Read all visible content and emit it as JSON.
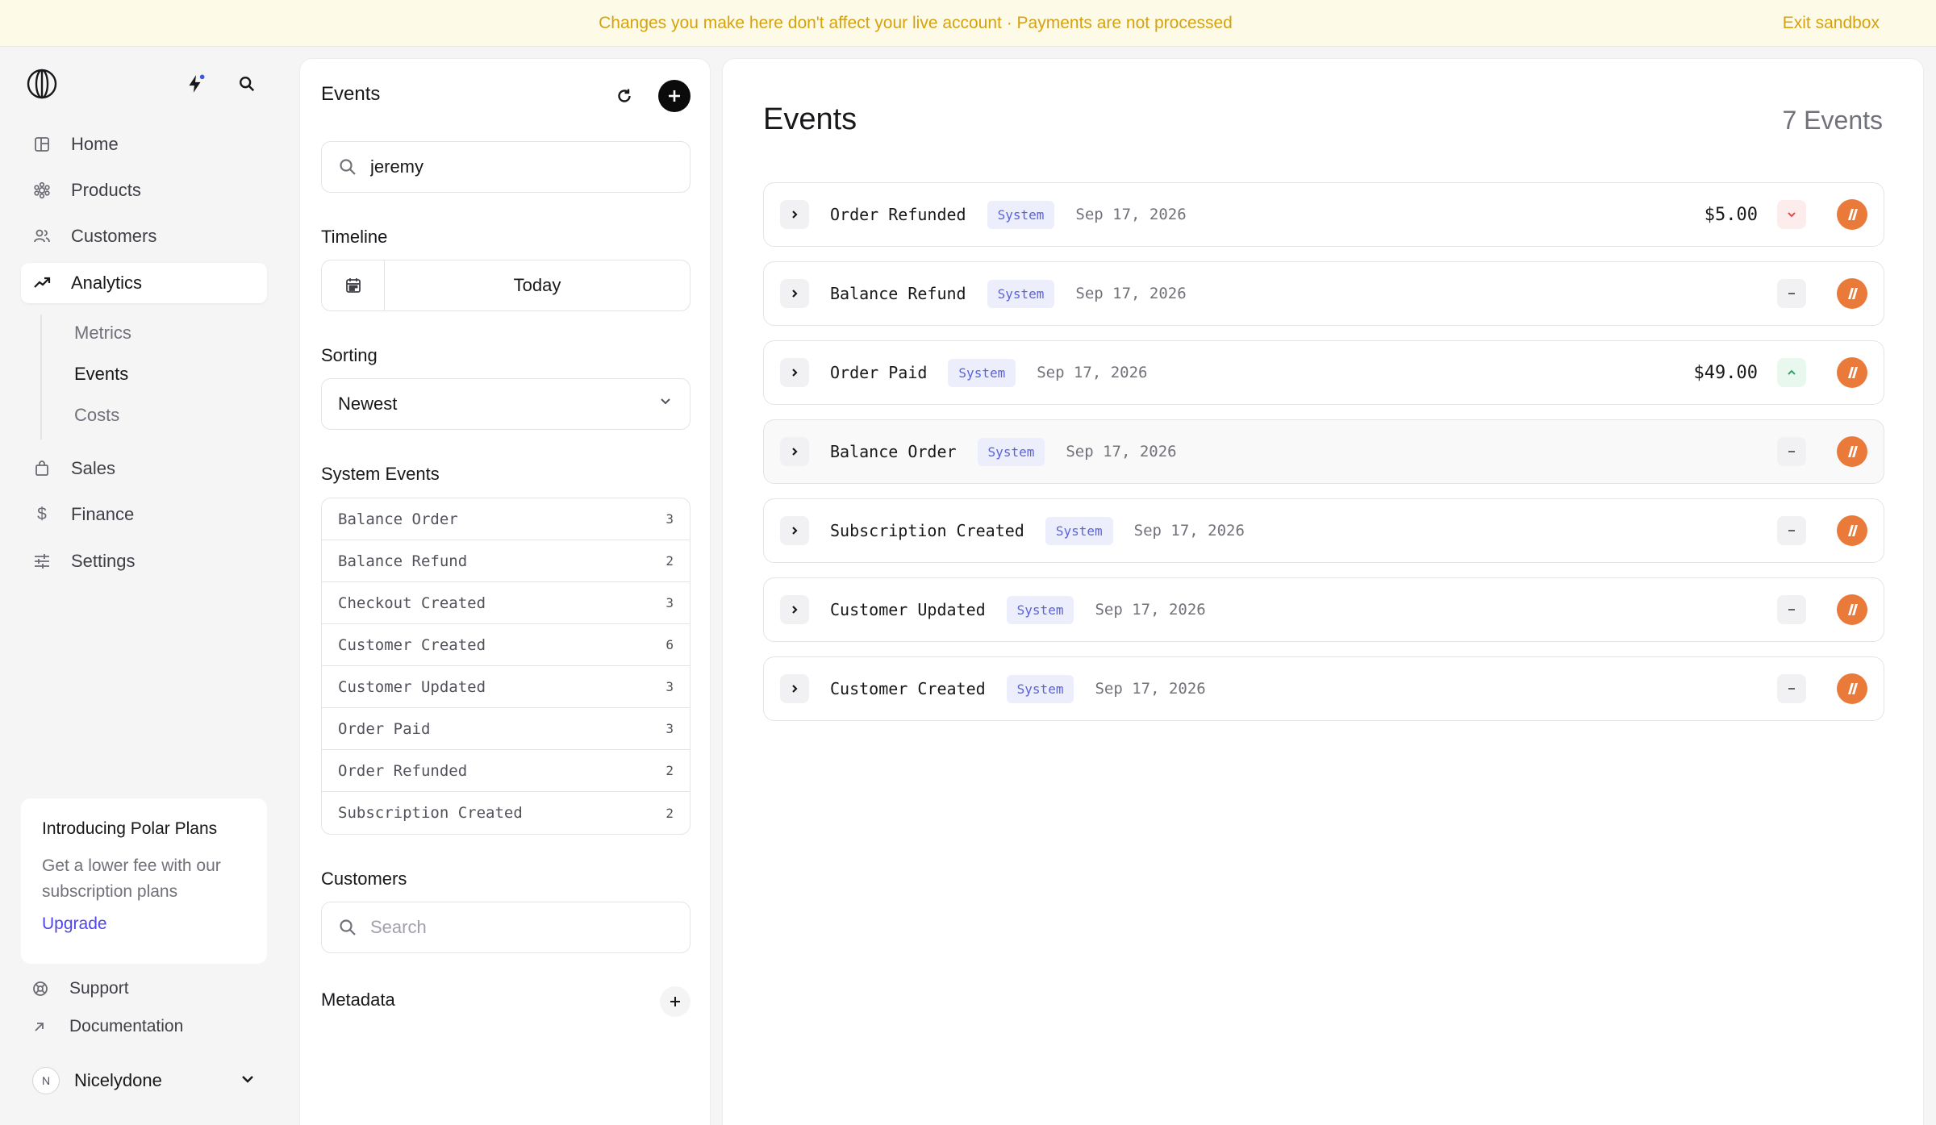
{
  "banner": {
    "message": "Changes you make here don't affect your live account · Payments are not processed",
    "exit_label": "Exit sandbox"
  },
  "sidebar": {
    "items": [
      {
        "label": "Home",
        "icon": "home-icon"
      },
      {
        "label": "Products",
        "icon": "products-icon"
      },
      {
        "label": "Customers",
        "icon": "customers-icon"
      },
      {
        "label": "Analytics",
        "icon": "analytics-icon"
      },
      {
        "label": "Sales",
        "icon": "sales-icon"
      },
      {
        "label": "Finance",
        "icon": "finance-icon"
      },
      {
        "label": "Settings",
        "icon": "settings-icon"
      }
    ],
    "subitems": [
      {
        "label": "Metrics"
      },
      {
        "label": "Events"
      },
      {
        "label": "Costs"
      }
    ],
    "active_item": "Analytics",
    "active_subitem": "Events",
    "promo": {
      "title": "Introducing Polar Plans",
      "description": "Get a lower fee with our subscription plans",
      "link": "Upgrade"
    },
    "footer": {
      "support": "Support",
      "documentation": "Documentation"
    },
    "user": {
      "initial": "N",
      "name": "Nicelydone"
    }
  },
  "filters": {
    "title": "Events",
    "search_value": "jeremy",
    "timeline_label": "Timeline",
    "timeline_value": "Today",
    "sorting_label": "Sorting",
    "sorting_value": "Newest",
    "system_events_label": "System Events",
    "system_events": [
      {
        "name": "Balance Order",
        "count": "3"
      },
      {
        "name": "Balance Refund",
        "count": "2"
      },
      {
        "name": "Checkout Created",
        "count": "3"
      },
      {
        "name": "Customer Created",
        "count": "6"
      },
      {
        "name": "Customer Updated",
        "count": "3"
      },
      {
        "name": "Order Paid",
        "count": "3"
      },
      {
        "name": "Order Refunded",
        "count": "2"
      },
      {
        "name": "Subscription Created",
        "count": "2"
      }
    ],
    "customers_label": "Customers",
    "customers_placeholder": "Search",
    "metadata_label": "Metadata"
  },
  "main": {
    "title": "Events",
    "count": "7 Events",
    "events": [
      {
        "name": "Order Refunded",
        "badge": "System",
        "date": "Sep 17, 2026",
        "amount": "$5.00",
        "trend": "down"
      },
      {
        "name": "Balance Refund",
        "badge": "System",
        "date": "Sep 17, 2026",
        "amount": "",
        "trend": "neutral"
      },
      {
        "name": "Order Paid",
        "badge": "System",
        "date": "Sep 17, 2026",
        "amount": "$49.00",
        "trend": "up"
      },
      {
        "name": "Balance Order",
        "badge": "System",
        "date": "Sep 17, 2026",
        "amount": "",
        "trend": "neutral"
      },
      {
        "name": "Subscription Created",
        "badge": "System",
        "date": "Sep 17, 2026",
        "amount": "",
        "trend": "neutral"
      },
      {
        "name": "Customer Updated",
        "badge": "System",
        "date": "Sep 17, 2026",
        "amount": "",
        "trend": "neutral"
      },
      {
        "name": "Customer Created",
        "badge": "System",
        "date": "Sep 17, 2026",
        "amount": "",
        "trend": "neutral"
      }
    ]
  },
  "colors": {
    "banner_text": "#d5a20f",
    "accent": "#4f46e5",
    "badge_text": "#5b63d6",
    "org_avatar": "#ea7a3a",
    "trend_down": "#e5484d",
    "trend_up": "#30a46c"
  }
}
